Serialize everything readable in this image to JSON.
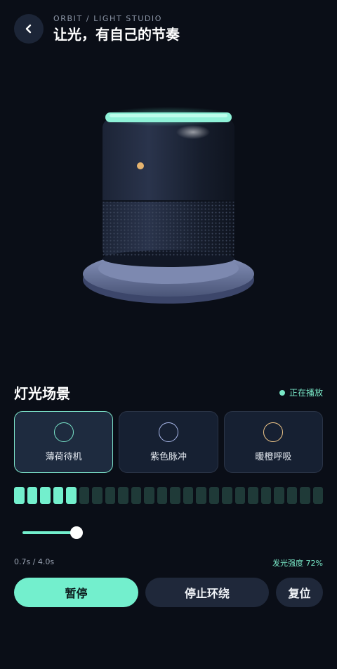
{
  "header": {
    "eyebrow": "ORBIT / LIGHT STUDIO",
    "title": "让光，有自己的节奏",
    "back_icon": "chevron-left-icon"
  },
  "scenes_section": {
    "title": "灯光场景",
    "status": "正在播放",
    "status_color": "#79e8c7"
  },
  "scenes": [
    {
      "label": "薄荷待机",
      "ring_color": "#78e3c8",
      "active": true
    },
    {
      "label": "紫色脉冲",
      "ring_color": "#a7b6e8",
      "active": false
    },
    {
      "label": "暖橙呼吸",
      "ring_color": "#f3c98a",
      "active": false
    }
  ],
  "level_bar": {
    "segments_total": 24,
    "segments_on": 5
  },
  "playback": {
    "slider_fraction": 0.175,
    "time": "0.7s / 4.0s",
    "intensity": "发光强度 72%"
  },
  "actions": {
    "pause": "暂停",
    "stop_orbit": "停止环绕",
    "reset": "复位"
  },
  "colors": {
    "accent": "#73efcd",
    "background": "#0a0e17",
    "card": "#162032"
  }
}
